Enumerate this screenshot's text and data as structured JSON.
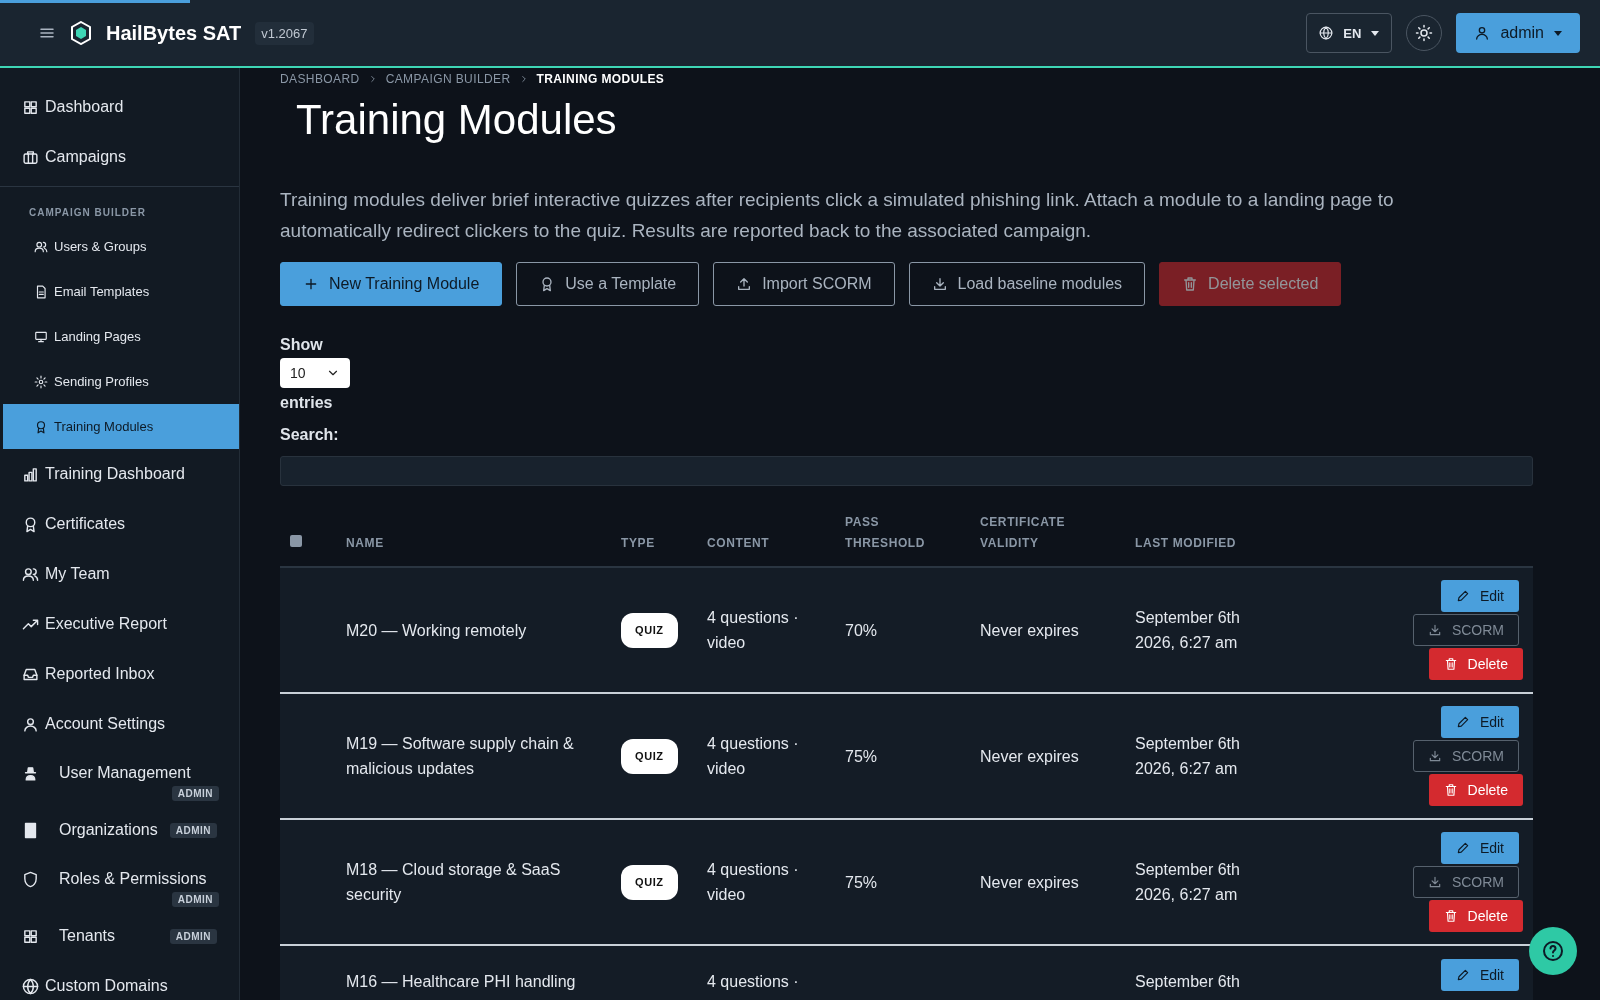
{
  "topbar": {
    "brand": "HailBytes SAT",
    "version": "v1.2067",
    "language": "EN",
    "user": "admin"
  },
  "sidebar": [
    {
      "kind": "item",
      "label": "Dashboard",
      "selected": false
    },
    {
      "kind": "item",
      "label": "Campaigns",
      "selected": false
    },
    {
      "kind": "section",
      "label": "CAMPAIGN BUILDER"
    },
    {
      "kind": "subitem",
      "label": "Users & Groups",
      "selected": false
    },
    {
      "kind": "subitem",
      "label": "Email Templates",
      "selected": false
    },
    {
      "kind": "subitem",
      "label": "Landing Pages",
      "selected": false
    },
    {
      "kind": "subitem",
      "label": "Sending Profiles",
      "selected": false
    },
    {
      "kind": "subitem",
      "label": "Training Modules",
      "selected": true
    },
    {
      "kind": "item",
      "label": "Training Dashboard",
      "selected": false
    },
    {
      "kind": "item",
      "label": "Certificates",
      "selected": false
    },
    {
      "kind": "item",
      "label": "My Team",
      "selected": false
    },
    {
      "kind": "item",
      "label": "Executive Report",
      "selected": false
    },
    {
      "kind": "item",
      "label": "Reported Inbox",
      "selected": false
    },
    {
      "kind": "item",
      "label": "Account Settings",
      "selected": false
    },
    {
      "kind": "item",
      "label": "User Management",
      "selected": false,
      "badge": "ADMIN",
      "badge_below": true
    },
    {
      "kind": "item",
      "label": "Organizations",
      "selected": false,
      "badge": "ADMIN",
      "badge_below": false
    },
    {
      "kind": "item",
      "label": "Roles & Permissions",
      "selected": false,
      "badge": "ADMIN",
      "badge_below": true
    },
    {
      "kind": "item",
      "label": "Tenants",
      "selected": false,
      "badge": "ADMIN",
      "badge_below": false
    },
    {
      "kind": "item",
      "label": "Custom Domains",
      "selected": false
    }
  ],
  "breadcrumb": [
    {
      "label": "DASHBOARD",
      "current": false
    },
    {
      "label": "CAMPAIGN BUILDER",
      "current": false
    },
    {
      "label": "TRAINING MODULES",
      "current": true
    }
  ],
  "title": "Training Modules",
  "description": "Training modules deliver brief interactive quizzes after recipients click a simulated phishing link. Attach a module to a landing page to automatically redirect clickers to the quiz. Results are reported back to the associated campaign.",
  "actions": [
    {
      "kind": "primary",
      "label": "New Training Module",
      "disabled": false
    },
    {
      "kind": "outline",
      "label": "Use a Template",
      "disabled": false
    },
    {
      "kind": "outline",
      "label": "Import SCORM",
      "disabled": false
    },
    {
      "kind": "outline",
      "label": "Load baseline modules",
      "disabled": false
    },
    {
      "kind": "danger",
      "label": "Delete selected",
      "disabled": true
    }
  ],
  "length": {
    "label_before": "Show",
    "value": "10",
    "label_after": "entries"
  },
  "search": {
    "label": "Search:"
  },
  "table": {
    "select_all": {
      "checked": false
    },
    "columns": [
      [
        "NAME"
      ],
      [
        "TYPE"
      ],
      [
        "CONTENT"
      ],
      [
        "PASS",
        "THRESHOLD"
      ],
      [
        "CERTIFICATE",
        "VALIDITY"
      ],
      [
        "LAST MODIFIED"
      ]
    ],
    "rows": [
      {
        "name": "M20 — Working remotely",
        "type": "QUIZ",
        "content": "4 questions · video",
        "threshold": "70%",
        "validity": "Never expires",
        "modified": "September 6th 2026, 6:27 am",
        "buttons": [
          "Edit",
          "SCORM",
          "Delete"
        ]
      },
      {
        "name": "M19 — Software supply chain & malicious updates",
        "type": "QUIZ",
        "content": "4 questions · video",
        "threshold": "75%",
        "validity": "Never expires",
        "modified": "September 6th 2026, 6:27 am",
        "buttons": [
          "Edit",
          "SCORM",
          "Delete"
        ]
      },
      {
        "name": "M18 — Cloud storage & SaaS security",
        "type": "QUIZ",
        "content": "4 questions · video",
        "threshold": "75%",
        "validity": "Never expires",
        "modified": "September 6th 2026, 6:27 am",
        "buttons": [
          "Edit",
          "SCORM",
          "Delete"
        ]
      },
      {
        "name": "M16 — Healthcare PHI handling",
        "content": "4 questions ·",
        "modified": "September 6th",
        "buttons": [
          "Edit"
        ]
      }
    ]
  }
}
